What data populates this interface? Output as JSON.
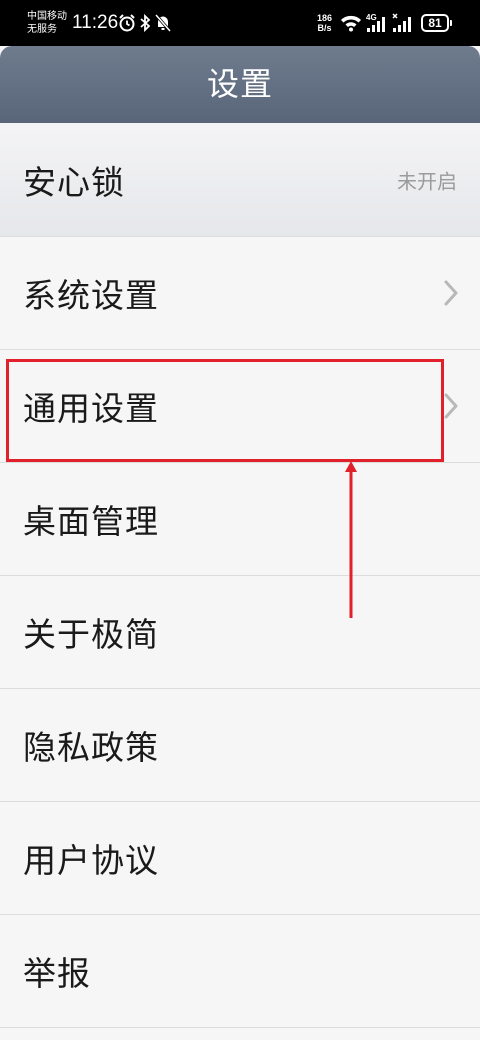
{
  "status_bar": {
    "carrier_line1": "中国移动",
    "carrier_line2": "无服务",
    "time": "11:26",
    "net_speed_value": "186",
    "net_speed_unit": "B/s",
    "network_type": "4G",
    "battery": "81",
    "icons": [
      "alarm-icon",
      "bluetooth-icon",
      "mute-icon",
      "wifi-icon",
      "signal-icon",
      "no-sim-icon"
    ]
  },
  "header": {
    "title": "设置"
  },
  "menu": {
    "items": [
      {
        "label": "安心锁",
        "value": "未开启"
      },
      {
        "label": "系统设置",
        "icon": "chevron-right-icon"
      },
      {
        "label": "通用设置",
        "icon": "chevron-right-icon"
      },
      {
        "label": "桌面管理"
      },
      {
        "label": "关于极简"
      },
      {
        "label": "隐私政策"
      },
      {
        "label": "用户协议"
      },
      {
        "label": "举报"
      }
    ]
  },
  "annotation": {
    "highlight_target": "通用设置",
    "color": "#e0202a"
  }
}
